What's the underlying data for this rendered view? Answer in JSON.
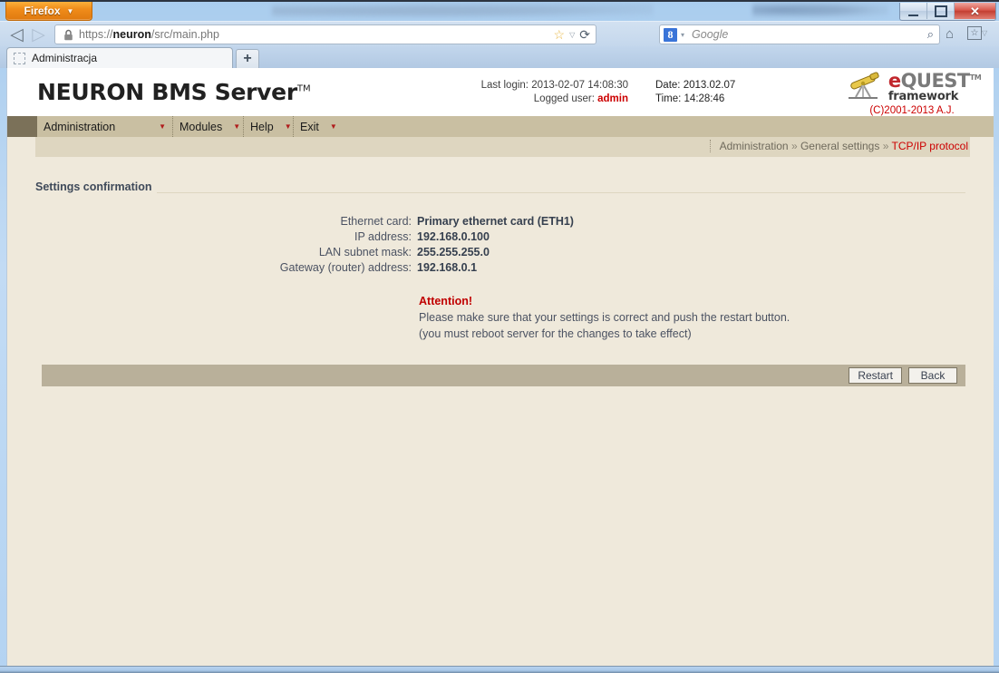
{
  "browser": {
    "app_button_label": "Firefox",
    "app_button_caret": "▼",
    "back_icon": "◁",
    "forward_icon": "▷",
    "lock_icon": "lock-icon",
    "url_prefix": "https://",
    "url_host": "neuron",
    "url_path": "/src/main.php",
    "star_icon": "☆",
    "star_caret": "▽",
    "reload_icon": "⟳",
    "search_engine": "8",
    "search_caret": "▾",
    "search_placeholder": "Google",
    "search_icon": "⌕",
    "home_icon": "⌂",
    "bookmarks_icon": "☆",
    "bookmarks_caret": "▽",
    "minimize_label": "",
    "maximize_label": "",
    "close_label": "✕",
    "tab_title": "Administracja",
    "new_tab_label": "+"
  },
  "app": {
    "brand": "NEURON BMS Server",
    "brand_tm": "TM",
    "session": {
      "last_login_label": "Last login:",
      "last_login_value": "2013-02-07 14:08:30",
      "logged_user_label": "Logged user:",
      "logged_user_value": "admin",
      "date_label": "Date:",
      "date_value": "2013.02.07",
      "time_label": "Time:",
      "time_value": "14:28:46"
    },
    "logo": {
      "e": "e",
      "rest": "QUEST",
      "tm": "TM",
      "framework": "framework",
      "copyright": "(C)2001-2013 A.J."
    },
    "menu": [
      {
        "label": "Administration",
        "caret": "▼"
      },
      {
        "label": "Modules",
        "caret": "▼"
      },
      {
        "label": "Help",
        "caret": "▼"
      },
      {
        "label": "Exit",
        "caret": "▼"
      }
    ],
    "breadcrumb": {
      "level1": "Administration",
      "sep1": "»",
      "level2": "General settings",
      "sep2": "»",
      "current": "TCP/IP protocol"
    }
  },
  "main": {
    "section_title": "Settings confirmation",
    "settings": [
      {
        "label": "Ethernet card:",
        "value": "Primary ethernet card (ETH1)"
      },
      {
        "label": "IP address:",
        "value": "192.168.0.100"
      },
      {
        "label": "LAN subnet mask:",
        "value": "255.255.255.0"
      },
      {
        "label": "Gateway (router) address:",
        "value": "192.168.0.1"
      }
    ],
    "attention": {
      "title": "Attention!",
      "line1": "Please make sure that your settings is correct and push the restart button.",
      "line2": "(you must reboot server for the changes to take effect)"
    },
    "buttons": {
      "restart": "Restart",
      "back": "Back"
    }
  },
  "colors": {
    "page_bg": "#efe9db",
    "menubar": "#c9bfa2",
    "menu_corner": "#7b7159",
    "crumb_bg": "#ded6c0",
    "accent_red": "#cc0000",
    "button_bar": "#b9b09a",
    "text_dark": "#36404f"
  }
}
